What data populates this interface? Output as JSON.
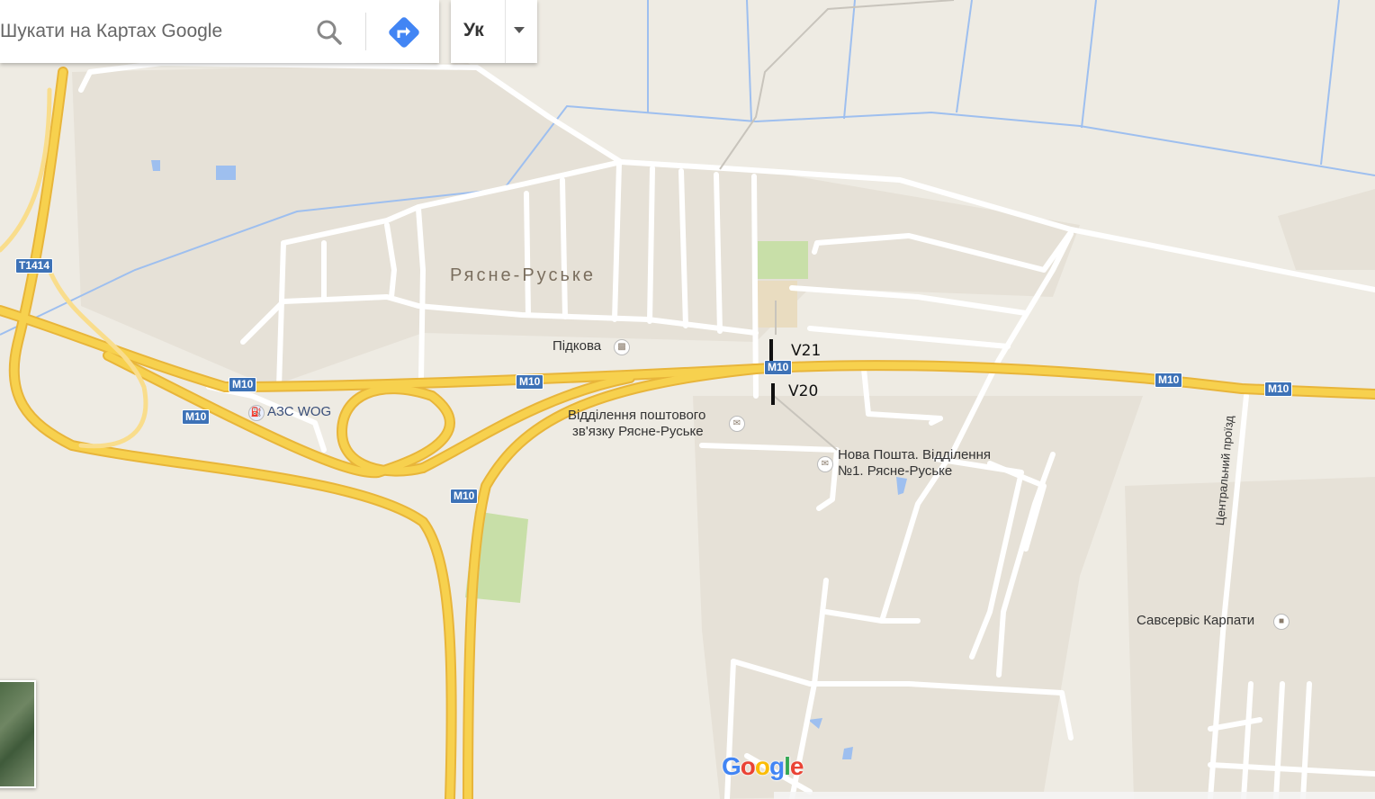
{
  "search": {
    "placeholder": "Шукати на Картах Google"
  },
  "language": {
    "label": "Ук"
  },
  "map": {
    "town_label": "Рясне-Руське",
    "roads": {
      "m10_labels": [
        "M10",
        "M10",
        "M10",
        "M10",
        "M10",
        "M10",
        "M10"
      ],
      "t1414_label": "T1414",
      "central_street": "Центральний проїзд"
    },
    "pois": {
      "gas_station": "АЗС WOG",
      "hotel": "Підкова",
      "post_office_line1": "Відділення поштового",
      "post_office_line2": "зв'язку Рясне-Руське",
      "nova_poshta_line1": "Нова Пошта. Відділення",
      "nova_poshta_line2": "№1. Рясне-Руське",
      "car_service": "Савсервіс Карпати"
    },
    "markers": {
      "v21": "V21",
      "v20": "V20"
    },
    "colors": {
      "background": "#eeebe3",
      "highway": "#f7d14e",
      "water": "#9ebfef",
      "park": "#c8dfa8",
      "road": "#ffffff"
    }
  },
  "branding": {
    "logo_text": [
      "G",
      "o",
      "o",
      "g",
      "l",
      "e"
    ]
  }
}
